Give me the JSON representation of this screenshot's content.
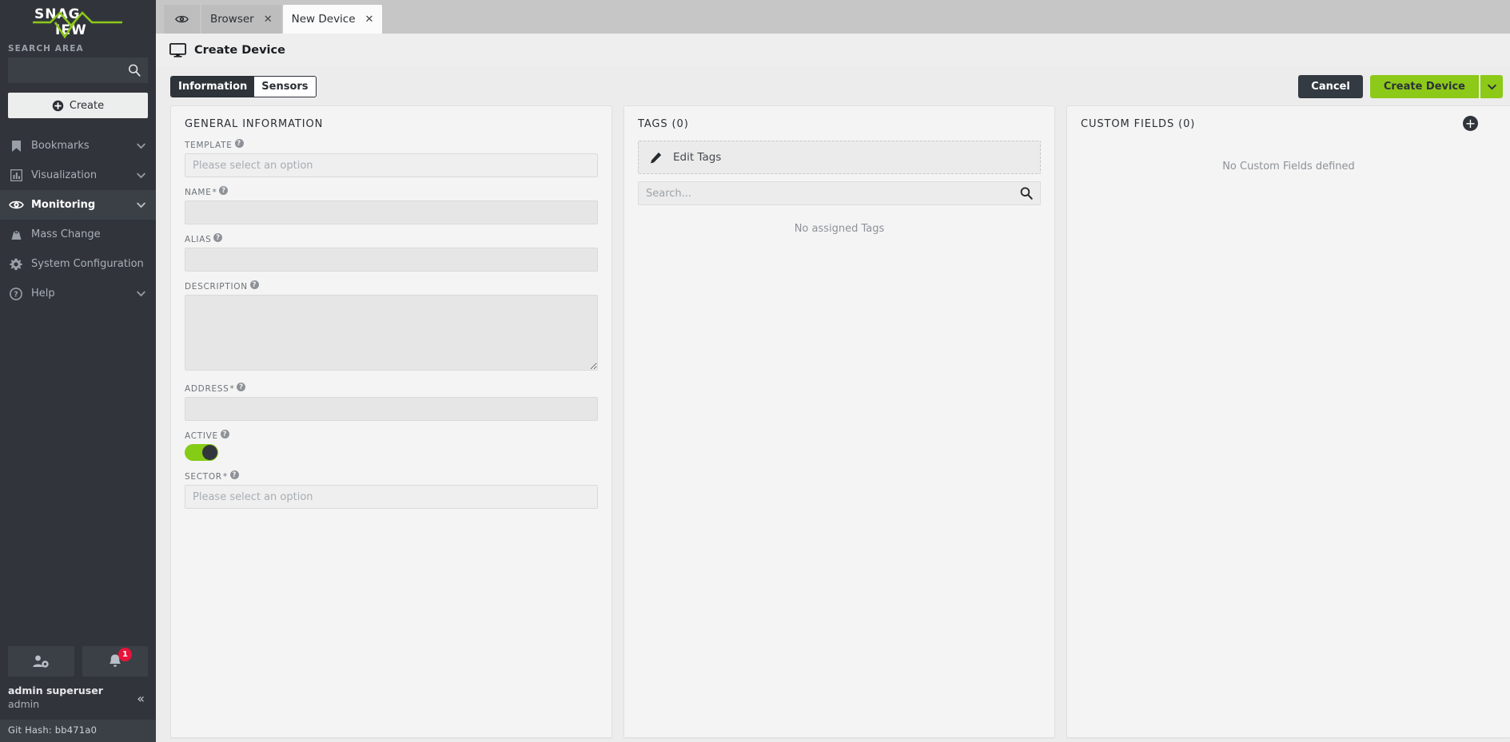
{
  "brand": {
    "name_part1": "SNAG",
    "name_part2": "VIEW",
    "accent": "#8dc919"
  },
  "sidebar": {
    "search_label": "SEARCH AREA",
    "search_value": "",
    "search_placeholder": "",
    "create_label": "Create",
    "items": [
      {
        "label": "Bookmarks",
        "icon": "bookmark-icon",
        "chevron": true,
        "active": false
      },
      {
        "label": "Visualization",
        "icon": "chart-icon",
        "chevron": true,
        "active": false
      },
      {
        "label": "Monitoring",
        "icon": "eye-icon",
        "chevron": true,
        "active": true
      },
      {
        "label": "Mass Change",
        "icon": "weight-icon",
        "chevron": false,
        "active": false
      },
      {
        "label": "System Configuration",
        "icon": "gear-icon",
        "chevron": false,
        "active": false
      },
      {
        "label": "Help",
        "icon": "question-circle-icon",
        "chevron": true,
        "active": false
      }
    ],
    "notification_count": "1",
    "user_name": "admin superuser",
    "user_login": "admin",
    "collapse_glyph": "«",
    "git_hash": "Git Hash: bb471a0"
  },
  "tabs": [
    {
      "label": "",
      "icon": "eye-icon",
      "closable": false,
      "active": false
    },
    {
      "label": "Browser",
      "closable": true,
      "active": false
    },
    {
      "label": "New Device",
      "closable": true,
      "active": true
    }
  ],
  "page": {
    "title": "Create Device",
    "icon": "monitor-icon"
  },
  "toolbar": {
    "segments": [
      {
        "label": "Information",
        "selected": true
      },
      {
        "label": "Sensors",
        "selected": false
      }
    ],
    "cancel_label": "Cancel",
    "create_label": "Create Device",
    "create_caret_icon": "chevron-down-icon",
    "cancel_color": "#343a41",
    "create_color": "#8dc919"
  },
  "general_information": {
    "title": "GENERAL INFORMATION",
    "fields": [
      {
        "label": "TEMPLATE",
        "required": false,
        "help": true,
        "type": "select",
        "value": "",
        "placeholder": "Please select an option"
      },
      {
        "label": "NAME",
        "required": true,
        "help": true,
        "type": "text",
        "value": "",
        "placeholder": ""
      },
      {
        "label": "ALIAS",
        "required": false,
        "help": true,
        "type": "text",
        "value": "",
        "placeholder": ""
      },
      {
        "label": "DESCRIPTION",
        "required": false,
        "help": true,
        "type": "textarea",
        "value": "",
        "placeholder": ""
      },
      {
        "label": "ADDRESS",
        "required": true,
        "help": true,
        "type": "text",
        "value": "",
        "placeholder": ""
      },
      {
        "label": "ACTIVE",
        "required": false,
        "help": true,
        "type": "toggle",
        "value": "on"
      },
      {
        "label": "SECTOR",
        "required": true,
        "help": true,
        "type": "select",
        "value": "",
        "placeholder": "Please select an option"
      }
    ]
  },
  "tags": {
    "title": "TAGS (0)",
    "edit_label": "Edit Tags",
    "edit_icon": "pencil-icon",
    "search_value": "",
    "search_placeholder": "Search...",
    "search_icon": "search-icon",
    "empty_message": "No assigned Tags"
  },
  "custom_fields": {
    "title": "CUSTOM FIELDS (0)",
    "add_icon": "plus-circle-icon",
    "empty_message": "No Custom Fields defined"
  }
}
